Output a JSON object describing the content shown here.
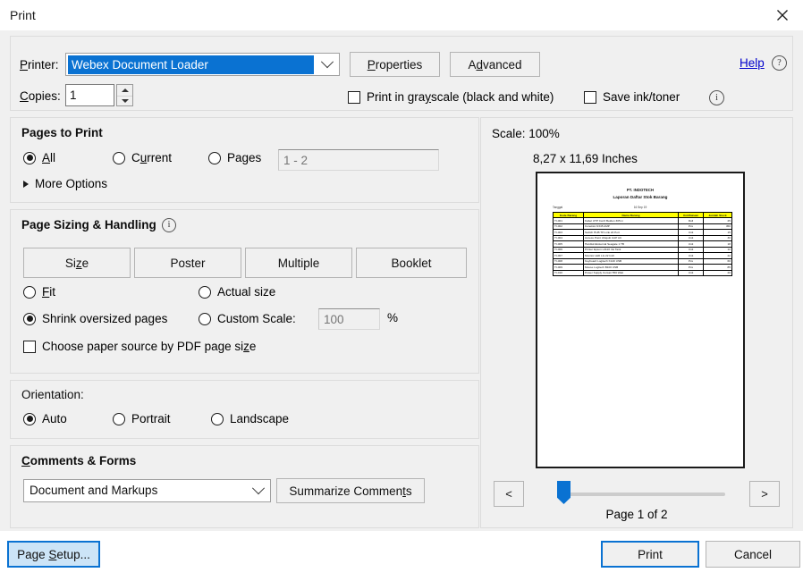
{
  "window": {
    "title": "Print",
    "close_icon": "close-icon"
  },
  "printer": {
    "label": "Printer:",
    "selected": "Webex Document Loader",
    "dropdown_icon": "chevron-down-icon",
    "properties_label": "Properties",
    "advanced_label": "Advanced",
    "help_label": "Help",
    "help_icon": "question-circle-icon",
    "copies_label": "Copies:",
    "copies_value": "1",
    "spinner_up_icon": "triangle-up-icon",
    "spinner_down_icon": "triangle-down-icon",
    "grayscale_label": "Print in grayscale (black and white)",
    "grayscale_checked": false,
    "save_ink_label": "Save ink/toner",
    "save_ink_checked": false,
    "info_icon": "info-circle-icon"
  },
  "pages_to_print": {
    "title": "Pages to Print",
    "options": [
      {
        "label": "All",
        "underline": "A",
        "checked": true
      },
      {
        "label": "Current",
        "underline": "u",
        "checked": false
      },
      {
        "label": "Pages",
        "underline": "g",
        "checked": false
      }
    ],
    "pages_placeholder": "1 - 2",
    "pages_value": "",
    "more_options_label": "More Options",
    "more_options_icon": "triangle-right-icon"
  },
  "page_sizing": {
    "title": "Page Sizing & Handling",
    "info_icon": "info-circle-icon",
    "buttons": [
      {
        "label": "Size"
      },
      {
        "label": "Poster"
      },
      {
        "label": "Multiple"
      },
      {
        "label": "Booklet"
      }
    ],
    "options": [
      {
        "label": "Fit",
        "checked": false
      },
      {
        "label": "Actual size",
        "checked": false
      },
      {
        "label": "Shrink oversized pages",
        "checked": true
      },
      {
        "label": "Custom Scale:",
        "checked": false
      }
    ],
    "custom_scale_value": "100",
    "percent_sign": "%",
    "paper_source_label": "Choose paper source by PDF page size",
    "paper_source_checked": false
  },
  "orientation": {
    "title": "Orientation:",
    "options": [
      {
        "label": "Auto",
        "checked": true
      },
      {
        "label": "Portrait",
        "checked": false
      },
      {
        "label": "Landscape",
        "checked": false
      }
    ]
  },
  "comments_forms": {
    "title": "Comments & Forms",
    "selected": "Document and Markups",
    "dropdown_icon": "chevron-down-icon",
    "summarize_label": "Summarize Comments"
  },
  "preview": {
    "scale_label": "Scale: 100%",
    "dimensions_label": "8,27 x 11,69 Inches",
    "prev_page_label": "<",
    "next_page_label": ">",
    "page_indicator": "Page 1 of 2",
    "slider_position_percent": 0,
    "document": {
      "company": "PT. INDOTECH",
      "subtitle": "Laporan Daftar Stok Barang",
      "date_label": "Tanggal",
      "date_value": "16 Sep 19",
      "columns": [
        "Kode Barang",
        "Nama Barang",
        "Unit/Satuan",
        "Jumlah Stock"
      ],
      "rows": [
        [
          "TI-001",
          "Kabel UTP Cat 6 Belden 305 m",
          "Roll",
          "25"
        ],
        [
          "TI-002",
          "Konektor RJ45 AMP",
          "Pcs",
          "450"
        ],
        [
          "TI-003",
          "Switch HUB TP-Link 24 Port",
          "Unit",
          "15"
        ],
        [
          "TI-004",
          "Access Point Ubiquiti UAP AC",
          "Unit",
          "30"
        ],
        [
          "TI-005",
          "Hardisk Eksternal Seagate 1 TB",
          "Unit",
          "18"
        ],
        [
          "TI-006",
          "Printer Epson L3110 Ink Tank",
          "Unit",
          "12"
        ],
        [
          "TI-007",
          "Monitor LED LG 22 Inch",
          "Unit",
          "22"
        ],
        [
          "TI-008",
          "Keyboard Logitech K120 USB",
          "Pcs",
          "60"
        ],
        [
          "TI-009",
          "Mouse Logitech B100 USB",
          "Pcs",
          "85"
        ],
        [
          "TI-010",
          "Power Supply Corsair 550 Watt",
          "Unit",
          "20"
        ]
      ]
    }
  },
  "footer": {
    "page_setup_label": "Page Setup...",
    "print_label": "Print",
    "cancel_label": "Cancel"
  }
}
